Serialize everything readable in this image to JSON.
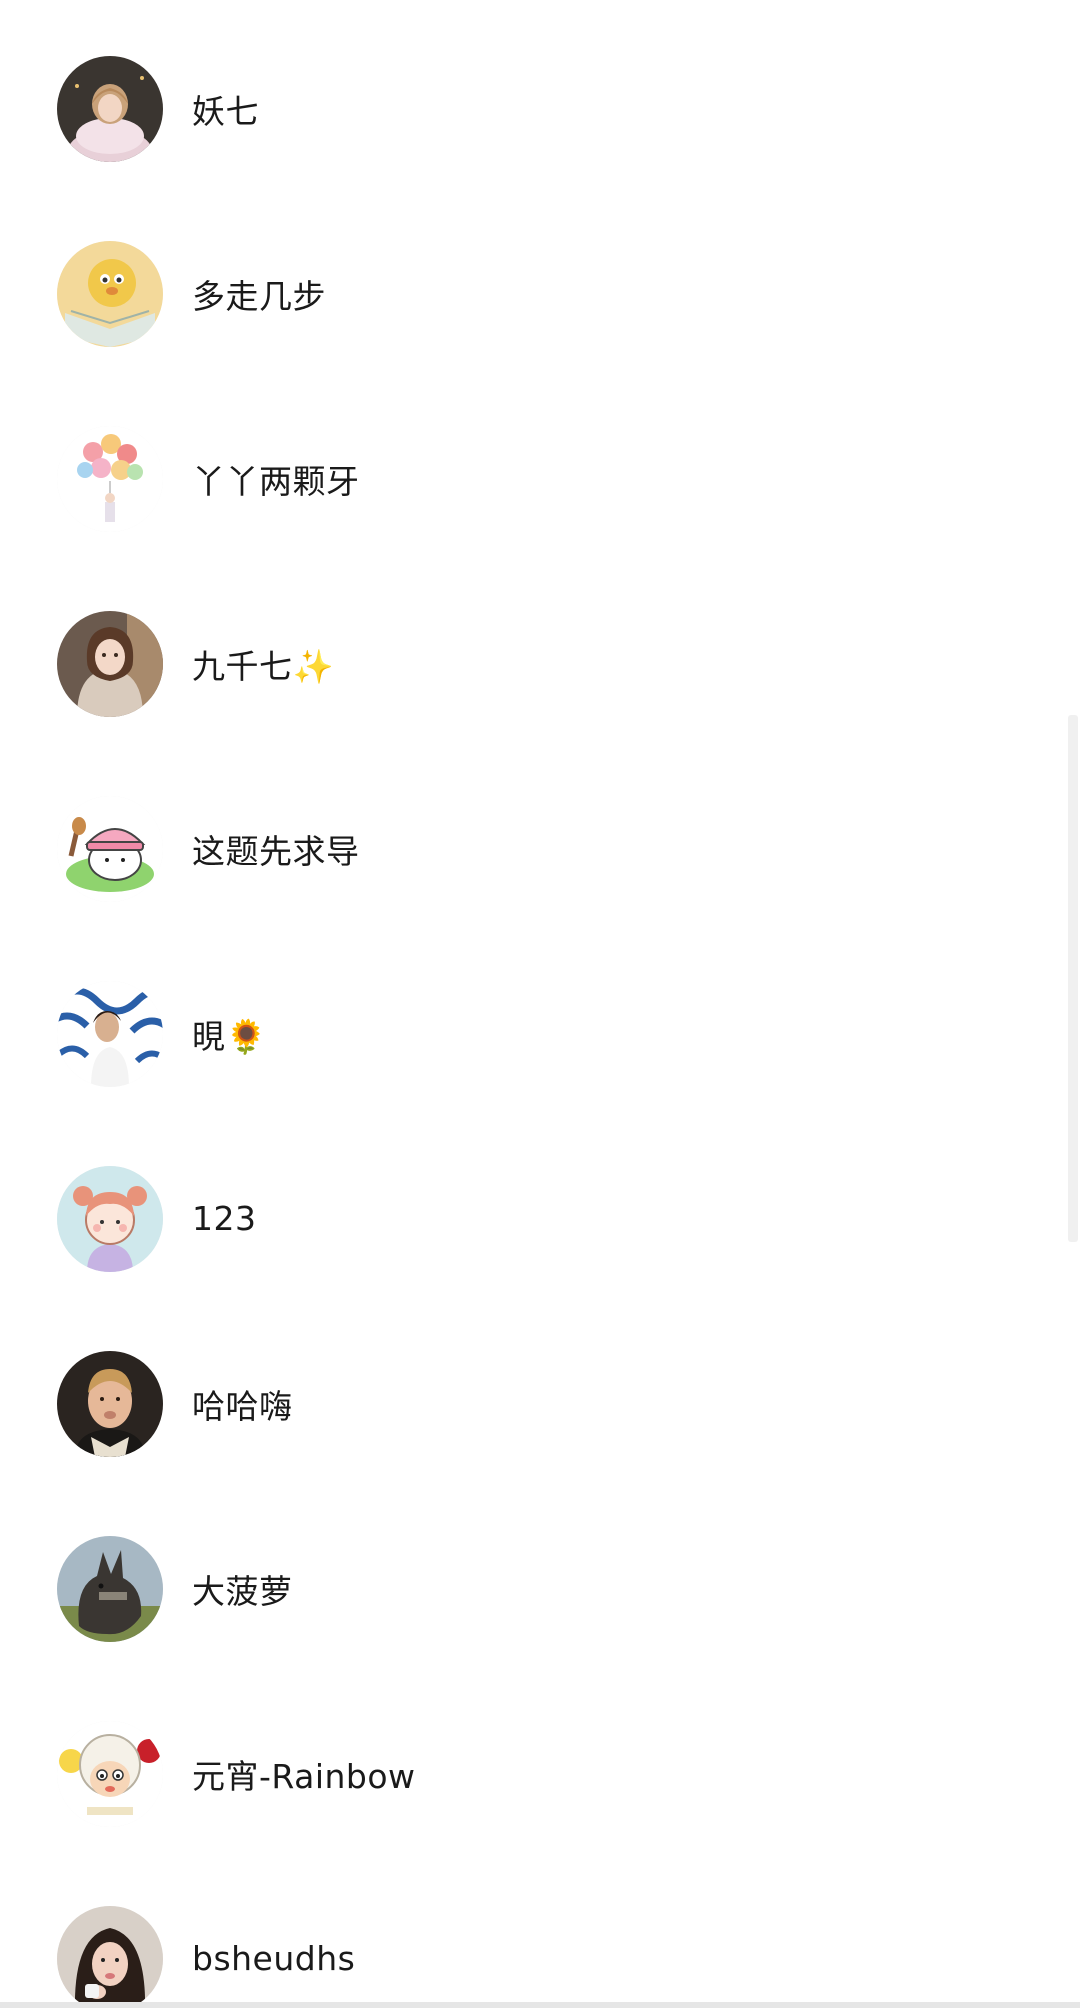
{
  "contacts": [
    {
      "name": "妖七",
      "avatar_icon": "girl-portrait-avatar-icon"
    },
    {
      "name": "多走几步",
      "avatar_icon": "cartoon-lion-book-avatar-icon"
    },
    {
      "name": "丫丫两颗牙",
      "avatar_icon": "balloon-bouquet-avatar-icon"
    },
    {
      "name": "九千七✨",
      "avatar_icon": "anime-girl-avatar-icon"
    },
    {
      "name": "这题先求导",
      "avatar_icon": "cartoon-bear-hat-avatar-icon"
    },
    {
      "name": "晛🌻",
      "avatar_icon": "woman-blue-pattern-avatar-icon"
    },
    {
      "name": "123",
      "avatar_icon": "cartoon-girl-pigtails-avatar-icon"
    },
    {
      "name": "哈哈嗨",
      "avatar_icon": "boy-face-avatar-icon"
    },
    {
      "name": "大菠萝",
      "avatar_icon": "donkey-avatar-icon"
    },
    {
      "name": "元宵-Rainbow",
      "avatar_icon": "cartoon-sheep-avatar-icon"
    },
    {
      "name": "bsheudhs",
      "avatar_icon": "woman-portrait-avatar-icon"
    }
  ],
  "colors": {
    "background": "#ffffff",
    "text": "#1a1a1a",
    "scrollbar": "#f0f0f0"
  }
}
